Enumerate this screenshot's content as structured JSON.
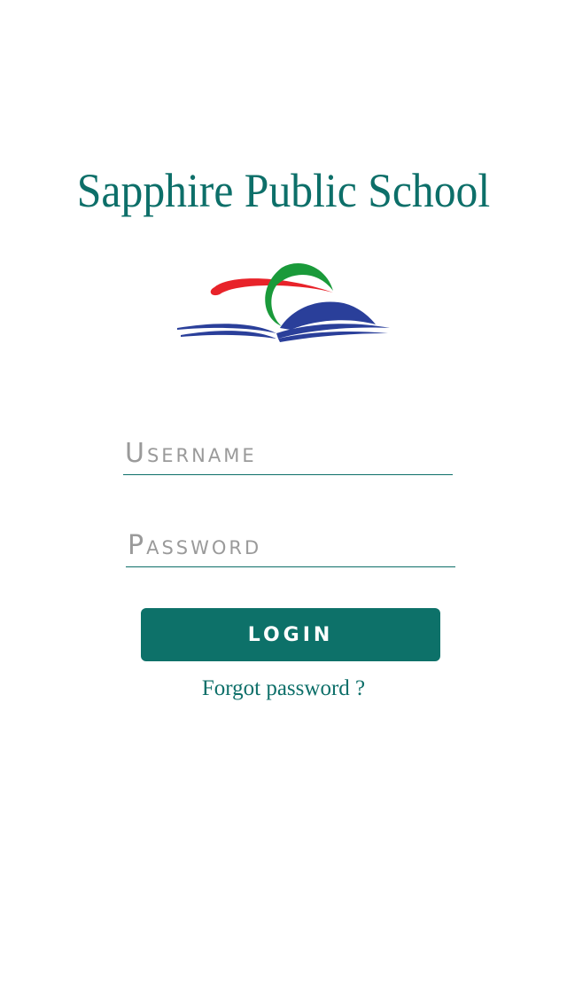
{
  "header": {
    "title": "Sapphire Public School"
  },
  "logo": {
    "icon": "open-book-logo",
    "colors": {
      "red": "#e8232a",
      "green": "#1a9a3a",
      "blue": "#2a3f9a"
    }
  },
  "form": {
    "username_placeholder": "Username",
    "password_placeholder": "Password",
    "login_label": "LOGIN",
    "forgot_label": "Forgot password ?"
  },
  "theme": {
    "primary": "#0d6f69",
    "background": "#ffffff"
  }
}
